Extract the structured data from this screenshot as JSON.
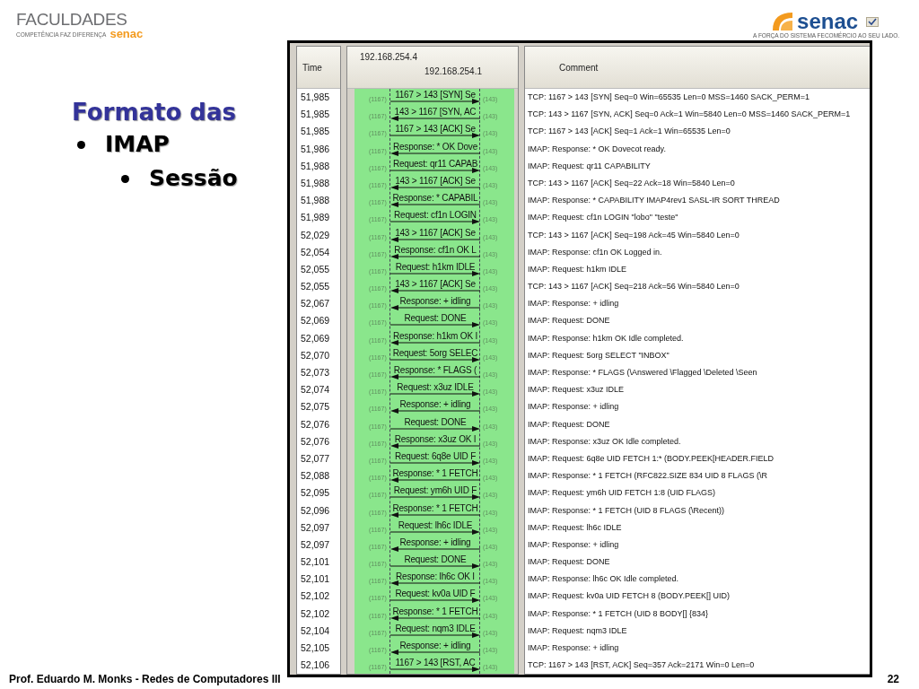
{
  "slide": {
    "logo_left": {
      "name": "FACULDADES",
      "tagline": "COMPETÊNCIA FAZ DIFERENÇA",
      "brand": "senac"
    },
    "logo_right": {
      "brand": "senac",
      "tagline": "A FORÇA DO SISTEMA FECOMÉRCIO AO SEU LADO."
    },
    "heading": "Formato das",
    "bullets": [
      {
        "text": "IMAP",
        "children": [
          {
            "text": "Sessão"
          }
        ]
      }
    ],
    "footer": "Prof. Eduardo M. Monks - Redes de Computadores III",
    "page_number": "22"
  },
  "window": {
    "columns": {
      "time": "Time",
      "host_a": "192.168.254.4",
      "host_b": "192.168.254.1",
      "comment": "Comment"
    },
    "rows": [
      {
        "time": "51,985",
        "label": "1167 > 143 [SYN] Se",
        "kind": "forward",
        "left_port": "(1167)",
        "right_port": "(143)",
        "comment": "TCP: 1167 > 143 [SYN] Seq=0 Win=65535 Len=0 MSS=1460 SACK_PERM=1"
      },
      {
        "time": "51,985",
        "label": "143 > 1167 [SYN, AC",
        "kind": "back",
        "left_port": "(1167)",
        "right_port": "(143)",
        "comment": "TCP: 143 > 1167 [SYN, ACK] Seq=0 Ack=1 Win=5840 Len=0 MSS=1460 SACK_PERM=1"
      },
      {
        "time": "51,985",
        "label": "1167 > 143 [ACK] Se",
        "kind": "forward",
        "left_port": "(1167)",
        "right_port": "(143)",
        "comment": "TCP: 1167 > 143 [ACK] Seq=1 Ack=1 Win=65535 Len=0"
      },
      {
        "time": "51,986",
        "label": "Response: * OK Dove",
        "kind": "back",
        "left_port": "(1167)",
        "right_port": "(143)",
        "comment": "IMAP: Response: * OK Dovecot ready."
      },
      {
        "time": "51,988",
        "label": "Request: qr11 CAPAB",
        "kind": "forward",
        "left_port": "(1167)",
        "right_port": "(143)",
        "comment": "IMAP: Request: qr11 CAPABILITY"
      },
      {
        "time": "51,988",
        "label": "143 > 1167 [ACK] Se",
        "kind": "back",
        "left_port": "(1167)",
        "right_port": "(143)",
        "comment": "TCP: 143 > 1167 [ACK] Seq=22 Ack=18 Win=5840 Len=0"
      },
      {
        "time": "51,988",
        "label": "Response: * CAPABIL",
        "kind": "back",
        "left_port": "(1167)",
        "right_port": "(143)",
        "comment": "IMAP: Response: * CAPABILITY IMAP4rev1 SASL-IR SORT THREAD"
      },
      {
        "time": "51,989",
        "label": "Request: cf1n LOGIN",
        "kind": "forward",
        "left_port": "(1167)",
        "right_port": "(143)",
        "comment": "IMAP: Request: cf1n LOGIN \"lobo\" \"teste\""
      },
      {
        "time": "52,029",
        "label": "143 > 1167 [ACK] Se",
        "kind": "back",
        "left_port": "(1167)",
        "right_port": "(143)",
        "comment": "TCP: 143 > 1167 [ACK] Seq=198 Ack=45 Win=5840 Len=0"
      },
      {
        "time": "52,054",
        "label": "Response: cf1n OK L",
        "kind": "back",
        "left_port": "(1167)",
        "right_port": "(143)",
        "comment": "IMAP: Response: cf1n OK Logged in."
      },
      {
        "time": "52,055",
        "label": "Request: h1km IDLE",
        "kind": "forward",
        "left_port": "(1167)",
        "right_port": "(143)",
        "comment": "IMAP: Request: h1km IDLE"
      },
      {
        "time": "52,055",
        "label": "143 > 1167 [ACK] Se",
        "kind": "back",
        "left_port": "(1167)",
        "right_port": "(143)",
        "comment": "TCP: 143 > 1167 [ACK] Seq=218 Ack=56 Win=5840 Len=0"
      },
      {
        "time": "52,067",
        "label": "Response: + idling",
        "kind": "back",
        "left_port": "(1167)",
        "right_port": "(143)",
        "comment": "IMAP: Response: + idling"
      },
      {
        "time": "52,069",
        "label": "Request: DONE",
        "kind": "forward",
        "left_port": "(1167)",
        "right_port": "(143)",
        "comment": "IMAP: Request: DONE"
      },
      {
        "time": "52,069",
        "label": "Response: h1km OK I",
        "kind": "back",
        "left_port": "(1167)",
        "right_port": "(143)",
        "comment": "IMAP: Response: h1km OK Idle completed."
      },
      {
        "time": "52,070",
        "label": "Request: 5org SELEC",
        "kind": "forward",
        "left_port": "(1167)",
        "right_port": "(143)",
        "comment": "IMAP: Request: 5org SELECT \"INBOX\""
      },
      {
        "time": "52,073",
        "label": "Response: * FLAGS (",
        "kind": "back",
        "left_port": "(1167)",
        "right_port": "(143)",
        "comment": "IMAP: Response: * FLAGS (\\Answered \\Flagged \\Deleted \\Seen"
      },
      {
        "time": "52,074",
        "label": "Request: x3uz IDLE",
        "kind": "forward",
        "left_port": "(1167)",
        "right_port": "(143)",
        "comment": "IMAP: Request: x3uz IDLE"
      },
      {
        "time": "52,075",
        "label": "Response: + idling",
        "kind": "back",
        "left_port": "(1167)",
        "right_port": "(143)",
        "comment": "IMAP: Response: + idling"
      },
      {
        "time": "52,076",
        "label": "Request: DONE",
        "kind": "forward",
        "left_port": "(1167)",
        "right_port": "(143)",
        "comment": "IMAP: Request: DONE"
      },
      {
        "time": "52,076",
        "label": "Response: x3uz OK I",
        "kind": "back",
        "left_port": "(1167)",
        "right_port": "(143)",
        "comment": "IMAP: Response: x3uz OK Idle completed."
      },
      {
        "time": "52,077",
        "label": "Request: 6q8e UID F",
        "kind": "forward",
        "left_port": "(1167)",
        "right_port": "(143)",
        "comment": "IMAP: Request: 6q8e UID FETCH 1:* (BODY.PEEK[HEADER.FIELD"
      },
      {
        "time": "52,088",
        "label": "Response: * 1 FETCH",
        "kind": "back",
        "left_port": "(1167)",
        "right_port": "(143)",
        "comment": "IMAP: Response: * 1 FETCH (RFC822.SIZE 834 UID 8 FLAGS (\\R"
      },
      {
        "time": "52,095",
        "label": "Request: ym6h UID F",
        "kind": "forward",
        "left_port": "(1167)",
        "right_port": "(143)",
        "comment": "IMAP: Request: ym6h UID FETCH 1:8 (UID FLAGS)"
      },
      {
        "time": "52,096",
        "label": "Response: * 1 FETCH",
        "kind": "back",
        "left_port": "(1167)",
        "right_port": "(143)",
        "comment": "IMAP: Response: * 1 FETCH (UID 8 FLAGS (\\Recent))"
      },
      {
        "time": "52,097",
        "label": "Request: lh6c IDLE",
        "kind": "forward",
        "left_port": "(1167)",
        "right_port": "(143)",
        "comment": "IMAP: Request: lh6c IDLE"
      },
      {
        "time": "52,097",
        "label": "Response: + idling",
        "kind": "back",
        "left_port": "(1167)",
        "right_port": "(143)",
        "comment": "IMAP: Response: + idling"
      },
      {
        "time": "52,101",
        "label": "Request: DONE",
        "kind": "forward",
        "left_port": "(1167)",
        "right_port": "(143)",
        "comment": "IMAP: Request: DONE"
      },
      {
        "time": "52,101",
        "label": "Response: lh6c OK I",
        "kind": "back",
        "left_port": "(1167)",
        "right_port": "(143)",
        "comment": "IMAP: Response: lh6c OK Idle completed."
      },
      {
        "time": "52,102",
        "label": "Request: kv0a UID F",
        "kind": "forward",
        "left_port": "(1167)",
        "right_port": "(143)",
        "comment": "IMAP: Request: kv0a UID FETCH 8 (BODY.PEEK[] UID)"
      },
      {
        "time": "52,102",
        "label": "Response: * 1 FETCH",
        "kind": "back",
        "left_port": "(1167)",
        "right_port": "(143)",
        "comment": "IMAP: Response: * 1 FETCH (UID 8 BODY[] {834}"
      },
      {
        "time": "52,104",
        "label": "Request: nqm3 IDLE",
        "kind": "forward",
        "left_port": "(1167)",
        "right_port": "(143)",
        "comment": "IMAP: Request: nqm3 IDLE"
      },
      {
        "time": "52,105",
        "label": "Response: + idling",
        "kind": "back",
        "left_port": "(1167)",
        "right_port": "(143)",
        "comment": "IMAP: Response: + idling"
      },
      {
        "time": "52,106",
        "label": "1167 > 143 [RST, AC",
        "kind": "forward",
        "left_port": "(1167)",
        "right_port": "(143)",
        "comment": "TCP: 1167 > 143 [RST, ACK] Seq=357 Ack=2171 Win=0 Len=0"
      }
    ]
  }
}
